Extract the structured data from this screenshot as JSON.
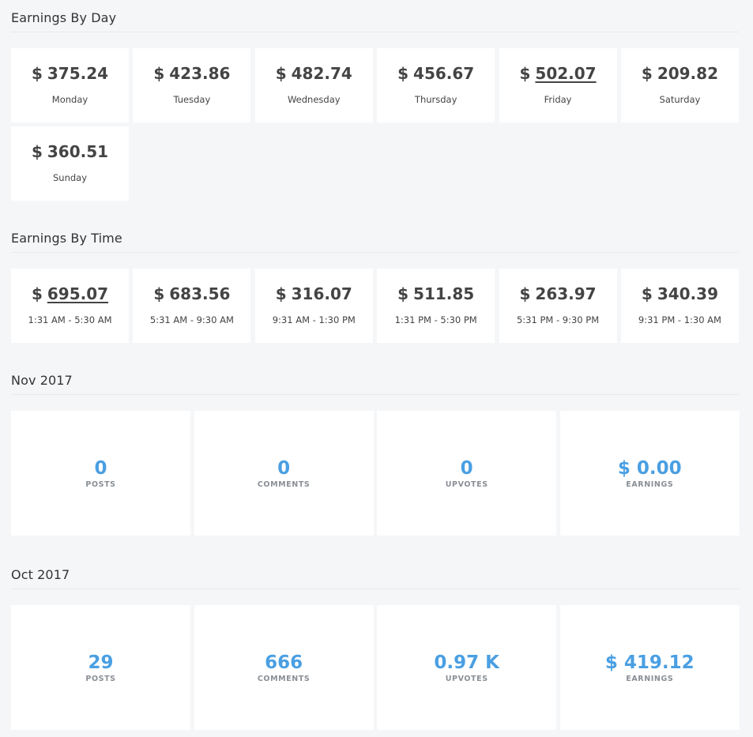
{
  "by_day": {
    "title": "Earnings By Day",
    "items": [
      {
        "currency": "$",
        "amount": "375.24",
        "label": "Monday"
      },
      {
        "currency": "$",
        "amount": "423.86",
        "label": "Tuesday"
      },
      {
        "currency": "$",
        "amount": "482.74",
        "label": "Wednesday"
      },
      {
        "currency": "$",
        "amount": "456.67",
        "label": "Thursday"
      },
      {
        "currency": "$",
        "amount": "502.07",
        "label": "Friday"
      },
      {
        "currency": "$",
        "amount": "209.82",
        "label": "Saturday"
      },
      {
        "currency": "$",
        "amount": "360.51",
        "label": "Sunday"
      }
    ]
  },
  "by_time": {
    "title": "Earnings By Time",
    "items": [
      {
        "currency": "$",
        "amount": "695.07",
        "label": "1:31 AM - 5:30 AM"
      },
      {
        "currency": "$",
        "amount": "683.56",
        "label": "5:31 AM - 9:30 AM"
      },
      {
        "currency": "$",
        "amount": "316.07",
        "label": "9:31 AM - 1:30 PM"
      },
      {
        "currency": "$",
        "amount": "511.85",
        "label": "1:31 PM - 5:30 PM"
      },
      {
        "currency": "$",
        "amount": "263.97",
        "label": "5:31 PM - 9:30 PM"
      },
      {
        "currency": "$",
        "amount": "340.39",
        "label": "9:31 PM - 1:30 AM"
      }
    ]
  },
  "nov": {
    "title": "Nov 2017",
    "stats": [
      {
        "value": "0",
        "label": "POSTS"
      },
      {
        "value": "0",
        "label": "COMMENTS"
      },
      {
        "value": "0",
        "label": "UPVOTES"
      },
      {
        "value": "$ 0.00",
        "label": "EARNINGS"
      }
    ]
  },
  "oct": {
    "title": "Oct 2017",
    "stats": [
      {
        "value": "29",
        "label": "POSTS"
      },
      {
        "value": "666",
        "label": "COMMENTS"
      },
      {
        "value": "0.97 K",
        "label": "UPVOTES"
      },
      {
        "value": "$ 419.12",
        "label": "EARNINGS"
      }
    ]
  },
  "colors": {
    "background": "#f5f6f8",
    "card": "#ffffff",
    "accent": "#4a9fe2",
    "stat_label": "#8a8f96"
  }
}
